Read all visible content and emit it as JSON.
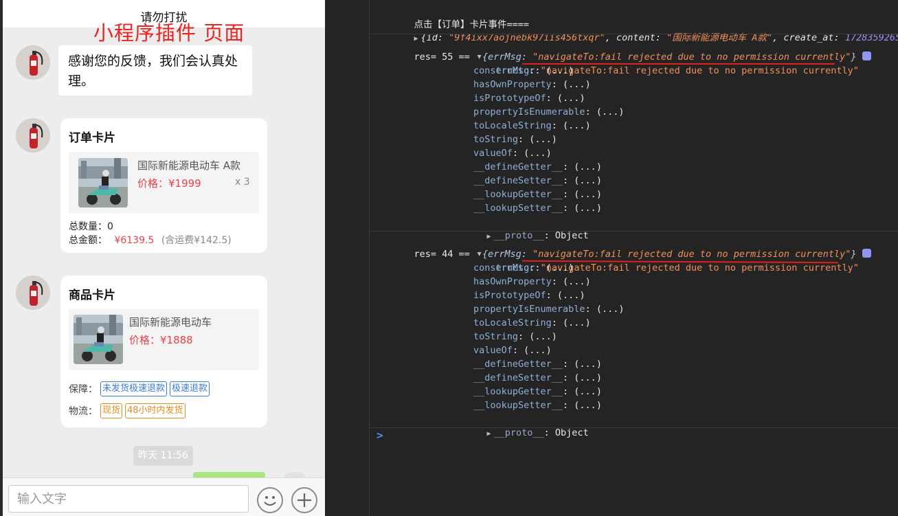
{
  "chat": {
    "nav_title": "请勿打扰",
    "overlay_label": "小程序插件  页面",
    "feedback_bubble": "感谢您的反馈，我们会认真处理。",
    "order_card": {
      "title": "订单卡片",
      "product_name": "国际新能源电动车 A款",
      "price": "价格：¥1999",
      "qty": "x 3",
      "total_qty_label": "总数量：",
      "total_qty_value": "0",
      "total_amount_label": "总金额：",
      "total_amount_value": "¥6139.5",
      "shipping_note": "(含运费¥142.5)"
    },
    "product_card": {
      "title": "商品卡片",
      "product_name": "国际新能源电动车",
      "price": "价格：¥1888",
      "guarantee_label": "保障：",
      "guarantee_tags": [
        "未发货极速退款",
        "极速退款"
      ],
      "logistics_label": "物流：",
      "logistics_tags": [
        "现货",
        "48小时内发货"
      ]
    },
    "time_chip": "昨天 11:56",
    "input_placeholder": "输入文字",
    "icons": {
      "avatar": "fire-extinguisher-avatar",
      "emoji": "smiley-icon",
      "plus": "plus-icon"
    }
  },
  "console": {
    "line1": "点击【订单】卡片事件====",
    "line2_prefix": "{id: ",
    "line2_id": "\"9f4ixx7aojnebk97iis456txqr\"",
    "line2_content_key": ", content: ",
    "line2_content": "\"国际新能源电动车 A款\"",
    "line2_create_key": ", create_at: ",
    "line2_create": "1728359265",
    "res1_label": "res= 55 ==",
    "res2_label": "res= 44 ==",
    "summary_key": "{errMsg: ",
    "summary_val": "\"navigateTo:fail rejected due to no permission currently\"",
    "summary_end": "}",
    "errmsg_key": "errMsg",
    "errmsg_val": "\"navigateTo:fail rejected due to no permission currently\"",
    "proto_methods": [
      "constructor",
      "hasOwnProperty",
      "isPrototypeOf",
      "propertyIsEnumerable",
      "toLocaleString",
      "toString",
      "valueOf",
      "__defineGetter__",
      "__defineSetter__",
      "__lookupGetter__",
      "__lookupSetter__"
    ],
    "method_suffix": ": (...)",
    "proto_key": "__proto__",
    "proto_val": ": Object",
    "prompt": ">",
    "colors": {
      "underline": "#e0201b",
      "string": "#f2905b",
      "number": "#a18ef0"
    }
  }
}
